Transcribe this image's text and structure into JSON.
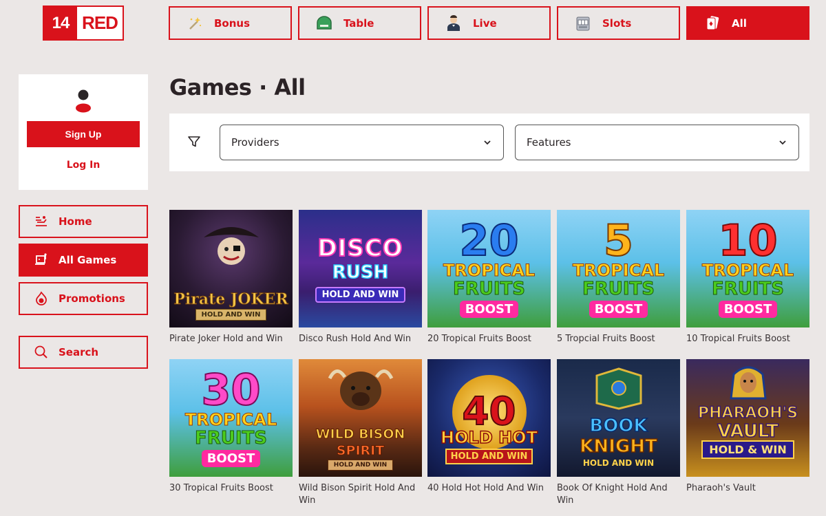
{
  "logo": {
    "number": "14",
    "word": "RED"
  },
  "categories": [
    {
      "label": "Bonus",
      "icon": "magic-wand-icon"
    },
    {
      "label": "Table",
      "icon": "table-icon"
    },
    {
      "label": "Live",
      "icon": "dealer-icon"
    },
    {
      "label": "Slots",
      "icon": "slot-machine-icon"
    },
    {
      "label": "All",
      "icon": "cards-icon",
      "active": true
    }
  ],
  "user_card": {
    "signup_label": "Sign Up",
    "login_label": "Log In"
  },
  "nav": [
    {
      "label": "Home",
      "icon": "home-icon"
    },
    {
      "label": "All Games",
      "icon": "games-icon",
      "active": true
    },
    {
      "label": "Promotions",
      "icon": "promotions-icon"
    },
    {
      "label": "Search",
      "icon": "search-icon"
    }
  ],
  "page": {
    "title": "Games · All"
  },
  "filters": {
    "providers_label": "Providers",
    "features_label": "Features"
  },
  "games": [
    {
      "name": "Pirate Joker Hold and Win",
      "art": [
        "Pirate JOKER",
        "",
        "HOLD AND WIN"
      ]
    },
    {
      "name": "Disco Rush Hold And Win",
      "art": [
        "DISCO",
        "RUSH",
        "HOLD AND WIN"
      ]
    },
    {
      "name": "20 Tropical Fruits Boost",
      "art": [
        "20",
        "TROPICAL",
        "FRUITS",
        "BOOST"
      ]
    },
    {
      "name": "5 Tropcial Fruits Boost",
      "art": [
        "5",
        "TROPICAL",
        "FRUITS",
        "BOOST"
      ]
    },
    {
      "name": "10 Tropical Fruits Boost",
      "art": [
        "10",
        "TROPICAL",
        "FRUITS",
        "BOOST"
      ]
    },
    {
      "name": "30 Tropical Fruits Boost",
      "art": [
        "30",
        "TROPICAL",
        "FRUITS",
        "BOOST"
      ]
    },
    {
      "name": "Wild Bison Spirit Hold And Win",
      "art": [
        "WILD BISON",
        "SPIRIT",
        "HOLD AND WIN"
      ]
    },
    {
      "name": "40 Hold Hot Hold And Win",
      "art": [
        "40",
        "HOLD HOT",
        "HOLD AND WIN"
      ]
    },
    {
      "name": "Book Of Knight Hold And Win",
      "art": [
        "BOOK",
        "KNIGHT",
        "HOLD AND WIN"
      ]
    },
    {
      "name": "Pharaoh's Vault",
      "art": [
        "PHARAOH'S",
        "VAULT",
        "HOLD & WIN"
      ]
    }
  ],
  "colors": {
    "brand_red": "#d9121b",
    "background": "#ebe7e6"
  }
}
